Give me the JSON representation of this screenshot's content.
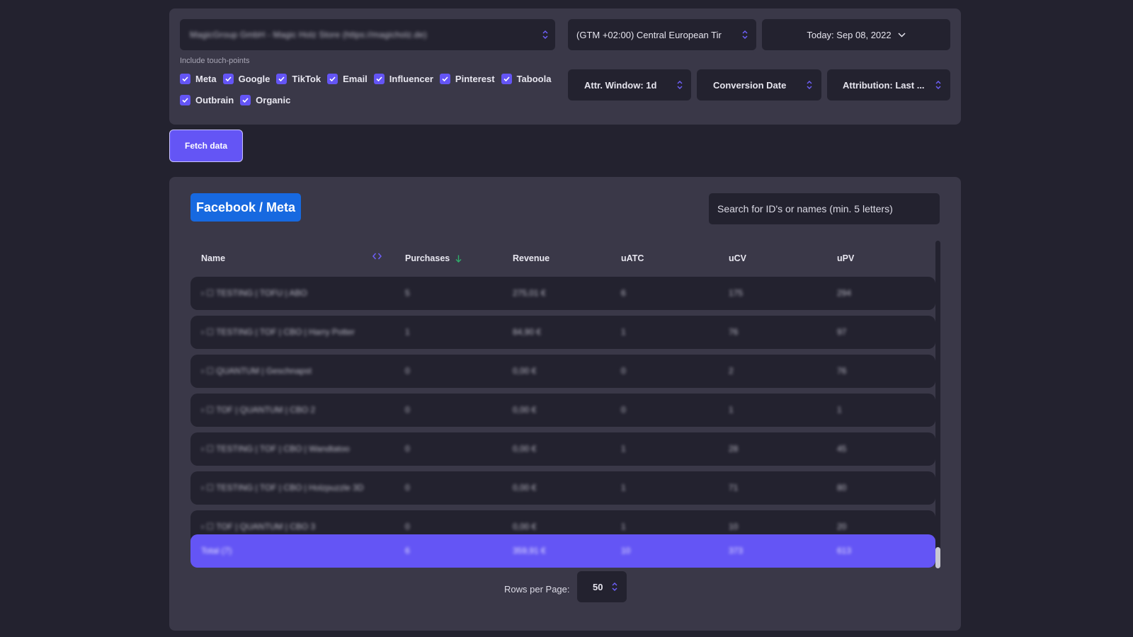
{
  "filters": {
    "site_select": {
      "value": "MagicGroup GmbH - Magic Holz Store (https://magicholz.de)"
    },
    "timezone_select": {
      "value": "(GTM +02:00)  Central European Tir"
    },
    "date_select": {
      "value": "Today: Sep 08, 2022"
    },
    "touchpoints_label": "Include touch-points",
    "touchpoints": [
      {
        "label": "Meta",
        "checked": true
      },
      {
        "label": "Google",
        "checked": true
      },
      {
        "label": "TikTok",
        "checked": true
      },
      {
        "label": "Email",
        "checked": true
      },
      {
        "label": "Influencer",
        "checked": true
      },
      {
        "label": "Pinterest",
        "checked": true
      },
      {
        "label": "Taboola",
        "checked": true
      },
      {
        "label": "Outbrain",
        "checked": true
      },
      {
        "label": "Organic",
        "checked": true
      }
    ],
    "attr_window": {
      "value": "Attr. Window: 1d"
    },
    "conversion_date": {
      "value": "Conversion Date"
    },
    "attribution": {
      "value": "Attribution: Last ..."
    }
  },
  "fetch_button": {
    "label": "Fetch data"
  },
  "results": {
    "title": "Facebook / Meta",
    "search": {
      "placeholder": "Search for ID's or names (min. 5 letters)",
      "value": ""
    },
    "columns": [
      "Name",
      "Purchases",
      "Revenue",
      "uATC",
      "uCV",
      "uPV"
    ],
    "sort": {
      "column": "Purchases",
      "direction": "desc"
    },
    "rows": [
      {
        "name": "› ☐ TESTING | TOFU | ABO",
        "purchases": "5",
        "revenue": "275,01 €",
        "uatc": "6",
        "ucv": "175",
        "upv": "294"
      },
      {
        "name": "› ☐ TESTING | TOF | CBO | Harry Potter",
        "purchases": "1",
        "revenue": "84,90 €",
        "uatc": "1",
        "ucv": "76",
        "upv": "97"
      },
      {
        "name": "› ☐ QUANTUM | Geschnapst",
        "purchases": "0",
        "revenue": "0,00 €",
        "uatc": "0",
        "ucv": "2",
        "upv": "76"
      },
      {
        "name": "› ☐ TOF | QUANTUM | CBO 2",
        "purchases": "0",
        "revenue": "0,00 €",
        "uatc": "0",
        "ucv": "1",
        "upv": "1"
      },
      {
        "name": "› ☐ TESTING | TOF | CBO | Wandtatoo",
        "purchases": "0",
        "revenue": "0,00 €",
        "uatc": "1",
        "ucv": "28",
        "upv": "45"
      },
      {
        "name": "› ☐ TESTING | TOF | CBO | Holzpuzzle 3D",
        "purchases": "0",
        "revenue": "0,00 €",
        "uatc": "1",
        "ucv": "71",
        "upv": "80"
      },
      {
        "name": "› ☐ TOF | QUANTUM | CBO 3",
        "purchases": "0",
        "revenue": "0,00 €",
        "uatc": "1",
        "ucv": "10",
        "upv": "20"
      }
    ],
    "total": {
      "name": "Total (7)",
      "purchases": "6",
      "revenue": "359,91 €",
      "uatc": "10",
      "ucv": "373",
      "upv": "613"
    },
    "rows_per_page_label": "Rows per Page:",
    "rows_per_page": "50"
  },
  "colors": {
    "accent": "#6455f5",
    "brand_facebook": "#1769e0",
    "background": "#23222f",
    "panel": "#3a3848",
    "sort_arrow": "#2fae6a"
  }
}
